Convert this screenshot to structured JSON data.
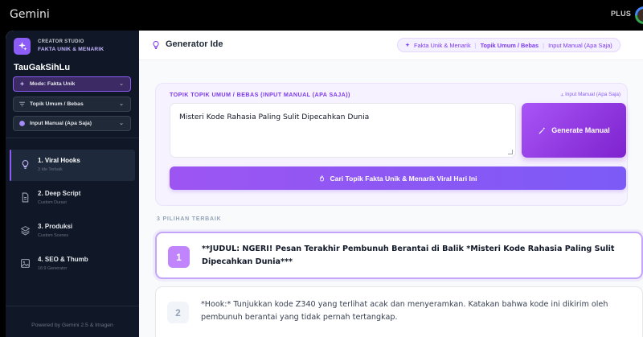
{
  "window": {
    "brand": "Gemini",
    "plan_badge": "PLUS"
  },
  "sidebar": {
    "studio_line1": "CREATOR STUDIO",
    "studio_line2": "FAKTA UNIK & MENARIK",
    "channel": "TauGakSihLu",
    "selects": [
      {
        "label": "Mode: Fakta Unik",
        "icon": "sparkle-icon"
      },
      {
        "label": "Topik Umum / Bebas",
        "icon": "filter-icon"
      },
      {
        "label": "Input Manual (Apa Saja)",
        "icon": "circle-icon"
      }
    ],
    "nav": [
      {
        "title": "1. Viral Hooks",
        "sub": "3 Ide Terbaik",
        "icon": "lightbulb-icon"
      },
      {
        "title": "2. Deep Script",
        "sub": "Custom Durasi",
        "icon": "document-icon"
      },
      {
        "title": "3. Produksi",
        "sub": "Custom Scenes",
        "icon": "layers-icon"
      },
      {
        "title": "4. SEO & Thumb",
        "sub": "16:9 Generator",
        "icon": "image-icon"
      }
    ],
    "footer": "Powered by Gemini 2.5 & Imagen"
  },
  "header": {
    "title": "Generator Ide",
    "crumbs": [
      "Fakta Unik & Menarik",
      "Topik Umum / Bebas",
      "Input Manual (Apa Saja)"
    ]
  },
  "input_card": {
    "label": "TOPIK TOPIK UMUM / BEBAS (INPUT MANUAL (APA SAJA))",
    "label_right": "Input Manual (Apa Saja)",
    "textarea_value": "Misteri Kode Rahasia Paling Sulit Dipecahkan Dunia",
    "generate_button": "Generate Manual",
    "find_button": "Cari Topik Fakta Unik & Menarik Viral Hari Ini"
  },
  "results": {
    "section_label": "3 PILIHAN TERBAIK",
    "items": [
      {
        "num": "1",
        "text": "**JUDUL: NGERI! Pesan Terakhir Pembunuh Berantai di Balik *Misteri Kode Rahasia Paling Sulit Dipecahkan Dunia***"
      },
      {
        "num": "2",
        "text": "*Hook:* Tunjukkan kode Z340 yang terlihat acak dan menyeramkan. Katakan bahwa kode ini dikirim oleh pembunuh berantai yang tidak pernah tertangkap."
      }
    ]
  },
  "colors": {
    "accent": "#8b5cf6",
    "sidebar_bg": "#101828"
  }
}
